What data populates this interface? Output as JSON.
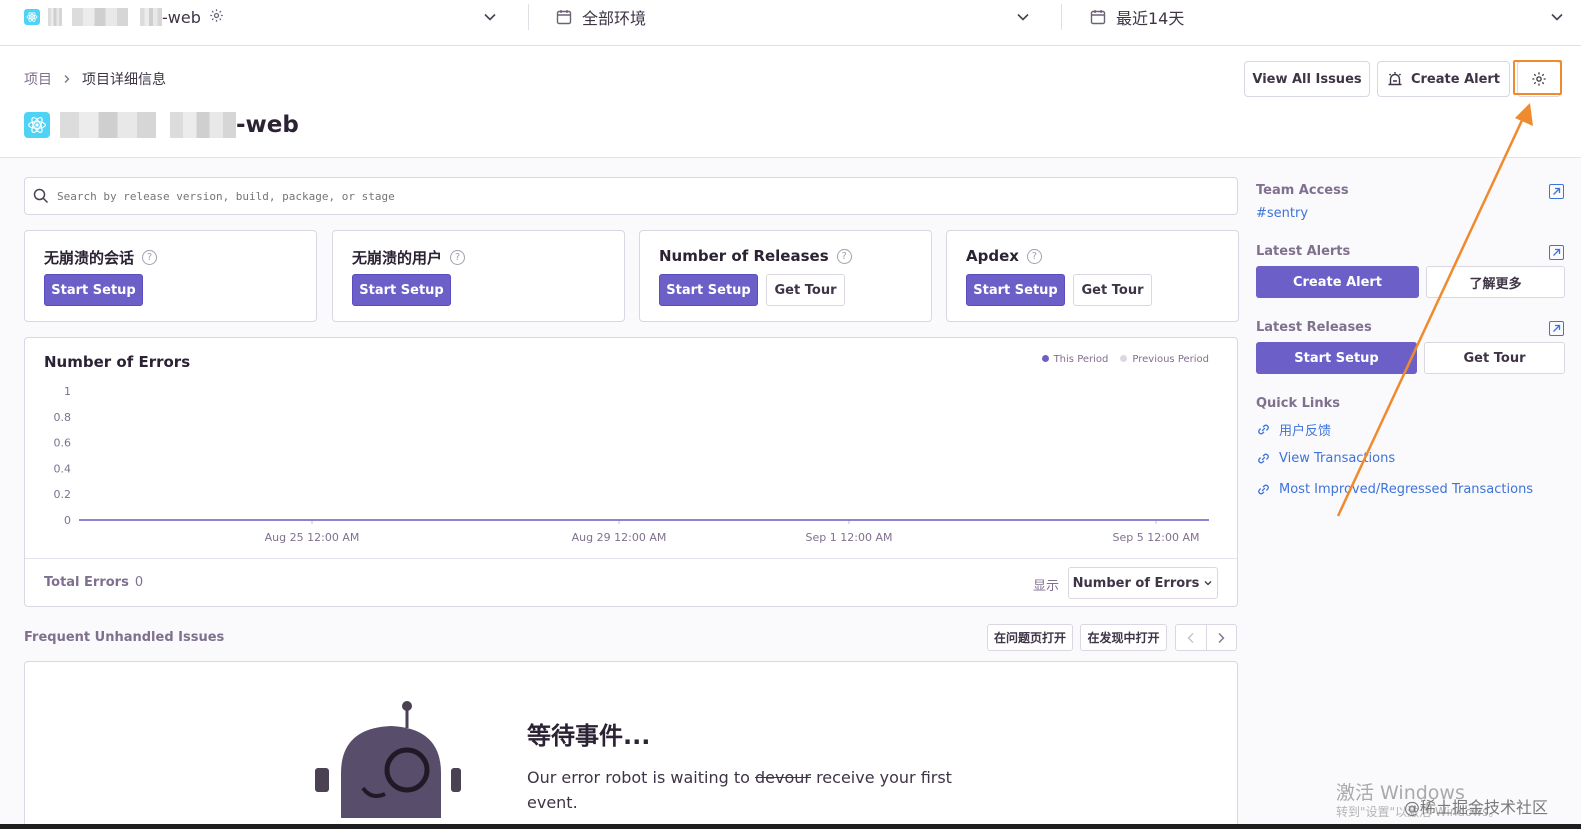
{
  "topbar": {
    "project_suffix": "-web",
    "environment": "全部环境",
    "period": "最近14天"
  },
  "breadcrumb": {
    "root": "项目",
    "current": "项目详细信息"
  },
  "project": {
    "name_suffix": "-web"
  },
  "header_actions": {
    "view_all_issues": "View All Issues",
    "create_alert": "Create Alert"
  },
  "search": {
    "placeholder": "Search by release version, build, package, or stage"
  },
  "score_cards": [
    {
      "title": "无崩溃的会话",
      "primary": "Start Setup"
    },
    {
      "title": "无崩溃的用户",
      "primary": "Start Setup"
    },
    {
      "title": "Number of Releases",
      "primary": "Start Setup",
      "secondary": "Get Tour"
    },
    {
      "title": "Apdex",
      "primary": "Start Setup",
      "secondary": "Get Tour"
    }
  ],
  "chart": {
    "title": "Number of Errors",
    "legend_this": "This Period",
    "legend_prev": "Previous Period",
    "total_label": "Total Errors",
    "total_value": "0",
    "show_label": "显示",
    "display_select": "Number of Errors",
    "colors": {
      "this_period": "#6c5fc7",
      "previous_period": "#dcd7e2"
    }
  },
  "chart_data": {
    "type": "line",
    "title": "Number of Errors",
    "y_ticks": [
      "0",
      "0.2",
      "0.4",
      "0.6",
      "0.8",
      "1"
    ],
    "x_ticks": [
      "Aug 25 12:00 AM",
      "Aug 29 12:00 AM",
      "Sep 1 12:00 AM",
      "Sep 5 12:00 AM"
    ],
    "ylim": [
      0,
      1
    ],
    "series": [
      {
        "name": "This Period",
        "values": [
          0,
          0,
          0,
          0
        ]
      },
      {
        "name": "Previous Period",
        "values": [
          0,
          0,
          0,
          0
        ]
      }
    ],
    "legend_position": "top-right"
  },
  "issues": {
    "title": "Frequent Unhandled Issues",
    "open_in_issues": "在问题页打开",
    "open_in_discover": "在发现中打开",
    "empty_title": "等待事件...",
    "empty_desc_before": "Our error robot is waiting to ",
    "empty_desc_strike": "devour",
    "empty_desc_after": " receive your first event."
  },
  "sidebar": {
    "team_access": "Team Access",
    "team_tag": "#sentry",
    "latest_alerts": "Latest Alerts",
    "create_alert": "Create Alert",
    "learn_more": "了解更多",
    "latest_releases": "Latest Releases",
    "start_setup": "Start Setup",
    "get_tour": "Get Tour",
    "quick_links": "Quick Links",
    "links": [
      "用户反馈",
      "View Transactions",
      "Most Improved/Regressed Transactions"
    ]
  },
  "watermark": {
    "line1": "激活 Windows",
    "line2": "转到\"设置\"以激活 Windows。",
    "community": "@稀土掘金技术社区"
  }
}
